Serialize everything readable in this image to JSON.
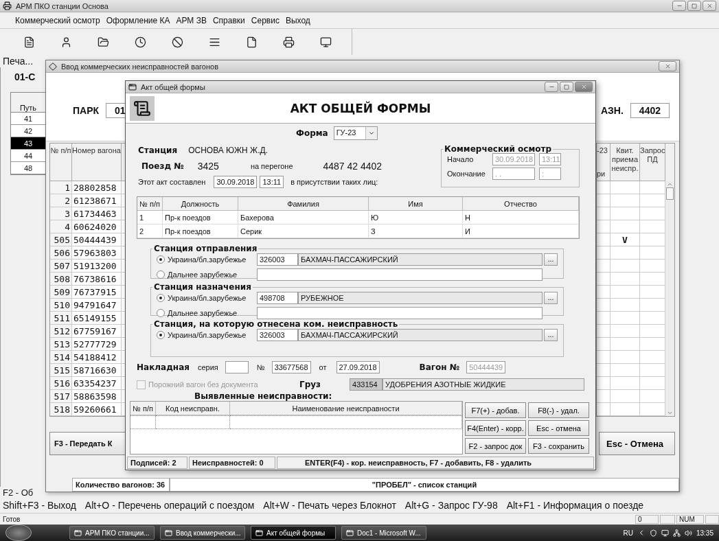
{
  "app": {
    "title": "АРМ ПКО  станции Основа",
    "menu": [
      "Коммерческий осмотр",
      "Оформление КА",
      "АРМ ЗВ",
      "Справки",
      "Сервис",
      "Выход"
    ],
    "toolbar_caption": "Печа...",
    "park": "01-С",
    "tracks": {
      "header": "Путь",
      "items": [
        {
          "label": "41",
          "selected": false
        },
        {
          "label": "42",
          "selected": false
        },
        {
          "label": "43",
          "selected": true
        },
        {
          "label": "44",
          "selected": false
        },
        {
          "label": "48",
          "selected": false
        }
      ]
    },
    "hint": "F2 - Об",
    "shortcuts": [
      "Shift+F3 - Выход",
      "Alt+O - Перечень операций с поездом",
      "Alt+W - Печать через Блокнот",
      "Alt+G - Запрос ГУ-98",
      "Alt+F1 - Информация о поезде"
    ],
    "status": {
      "text": "Готов",
      "fields": [
        "0",
        "NUM"
      ]
    }
  },
  "defects_window": {
    "title": "Ввод коммерческих неисправностей вагонов",
    "park_label": "ПАРК",
    "park_value": "01",
    "dest_label": "АЗН.",
    "dest_value": "4402",
    "left_columns": [
      "№ п/п",
      "Номер вагона"
    ],
    "partial_column": [
      "-23",
      "ри"
    ],
    "right_columns": [
      "Квит. приема неиспр.",
      "Запрос ПД"
    ],
    "rows": [
      {
        "n": "1",
        "wagon": "28802858"
      },
      {
        "n": "2",
        "wagon": "61238671"
      },
      {
        "n": "3",
        "wagon": "61734463"
      },
      {
        "n": "4",
        "wagon": "60624020"
      },
      {
        "n": "505",
        "wagon": "50444439",
        "receipt": "V"
      },
      {
        "n": "506",
        "wagon": "57963803"
      },
      {
        "n": "507",
        "wagon": "51913200"
      },
      {
        "n": "508",
        "wagon": "76738616"
      },
      {
        "n": "509",
        "wagon": "76737915"
      },
      {
        "n": "510",
        "wagon": "94791647"
      },
      {
        "n": "511",
        "wagon": "65149155"
      },
      {
        "n": "512",
        "wagon": "67759167"
      },
      {
        "n": "513",
        "wagon": "52777729"
      },
      {
        "n": "514",
        "wagon": "54188412"
      },
      {
        "n": "515",
        "wagon": "58716630"
      },
      {
        "n": "516",
        "wagon": "63354237"
      },
      {
        "n": "517",
        "wagon": "58863598"
      },
      {
        "n": "518",
        "wagon": "59260661"
      }
    ],
    "send_button": "F3 - Передать К",
    "cancel_button": "Esc - Отмена",
    "count": "Количество вагонов: 36",
    "hint": "\"ПРОБЕЛ\" - список станций"
  },
  "act_dialog": {
    "title": "Акт общей формы",
    "heading": "АКТ ОБЩЕЙ ФОРМЫ",
    "form_label": "Форма",
    "form_value": "ГУ-23",
    "station_label": "Станция",
    "station_value": "ОСНОВА ЮЖН Ж.Д.",
    "train_label": "Поезд №",
    "train_value": "3425",
    "stretch_label": "на перегоне",
    "stretch_value": "4487 42 4402",
    "act_label": "Этот акт составлен",
    "act_date": "30.09.2018",
    "act_time": "13:11",
    "presence_label": "в присутствии таких лиц:",
    "inspection": {
      "title": "Коммерческий осмотр",
      "start_label": "Начало",
      "start_date": "30.09.2018",
      "start_time": "13:11",
      "end_label": "Окончание",
      "end_date": ". .",
      "end_time": ":"
    },
    "persons": {
      "columns": [
        "№ п/п",
        "Должность",
        "Фамилия",
        "Имя",
        "Отчество"
      ],
      "rows": [
        [
          "1",
          "Пр-к поездов",
          "Бахерова",
          "Ю",
          "Н"
        ],
        [
          "2",
          "Пр-к поездов",
          "Серик",
          "З",
          "И"
        ]
      ]
    },
    "station_groups": [
      {
        "title": "Станция отправления",
        "options": [
          {
            "label": "Украина/бл.зарубежье",
            "selected": true,
            "code": "326003",
            "name": "БАХМАЧ-ПАССАЖИРСКИЙ",
            "browse": "..."
          },
          {
            "label": "Дальнее зарубежье",
            "selected": false
          }
        ]
      },
      {
        "title": "Станция назначения",
        "options": [
          {
            "label": "Украина/бл.зарубежье",
            "selected": true,
            "code": "498708",
            "name": "РУБЕЖНОЕ",
            "browse": "..."
          },
          {
            "label": "Дальнее зарубежье",
            "selected": false
          }
        ]
      },
      {
        "title": "Станция, на которую отнесена ком. неисправность",
        "options": [
          {
            "label": "Украина/бл.зарубежье",
            "selected": true,
            "code": "326003",
            "name": "БАХМАЧ-ПАССАЖИРСКИЙ",
            "browse": "..."
          }
        ]
      }
    ],
    "waybill": {
      "label": "Накладная",
      "series_label": "серия",
      "number_label": "№",
      "number": "33677568",
      "date_label": "от",
      "date": "27.09.2018",
      "wagon_label": "Вагон №",
      "wagon": "50444439"
    },
    "empty_wagon": {
      "label": "Порожний вагон без документа",
      "checked": false,
      "disabled": true
    },
    "cargo": {
      "label": "Груз",
      "code": "433154",
      "name": "УДОБРЕНИЯ АЗОТНЫЕ ЖИДКИЕ"
    },
    "defects": {
      "title": "Выявленные неисправности:",
      "columns": [
        "№ п/п",
        "Код неисправн.",
        "Наименование неисправности"
      ]
    },
    "buttons": [
      "F7(+) - добав.",
      "F8(-) - удал.",
      "F4(Enter) - корр.",
      "Esc - отмена",
      "F2 - запрос док",
      "F3 - сохранить"
    ],
    "status": [
      "Подписей:  2",
      "Неисправностей:  0",
      "ENTER(F4) - кор. неисправность, F7 - добавить, F8 - удалить"
    ]
  },
  "taskbar": {
    "items": [
      {
        "label": "АРМ ПКО  станции...",
        "selected": false
      },
      {
        "label": "Ввод коммерчески...",
        "selected": false
      },
      {
        "label": "Акт общей формы",
        "selected": true
      },
      {
        "label": "Doc1 - Microsoft W...",
        "selected": false
      }
    ],
    "lang": "RU",
    "clock": "13:35"
  }
}
